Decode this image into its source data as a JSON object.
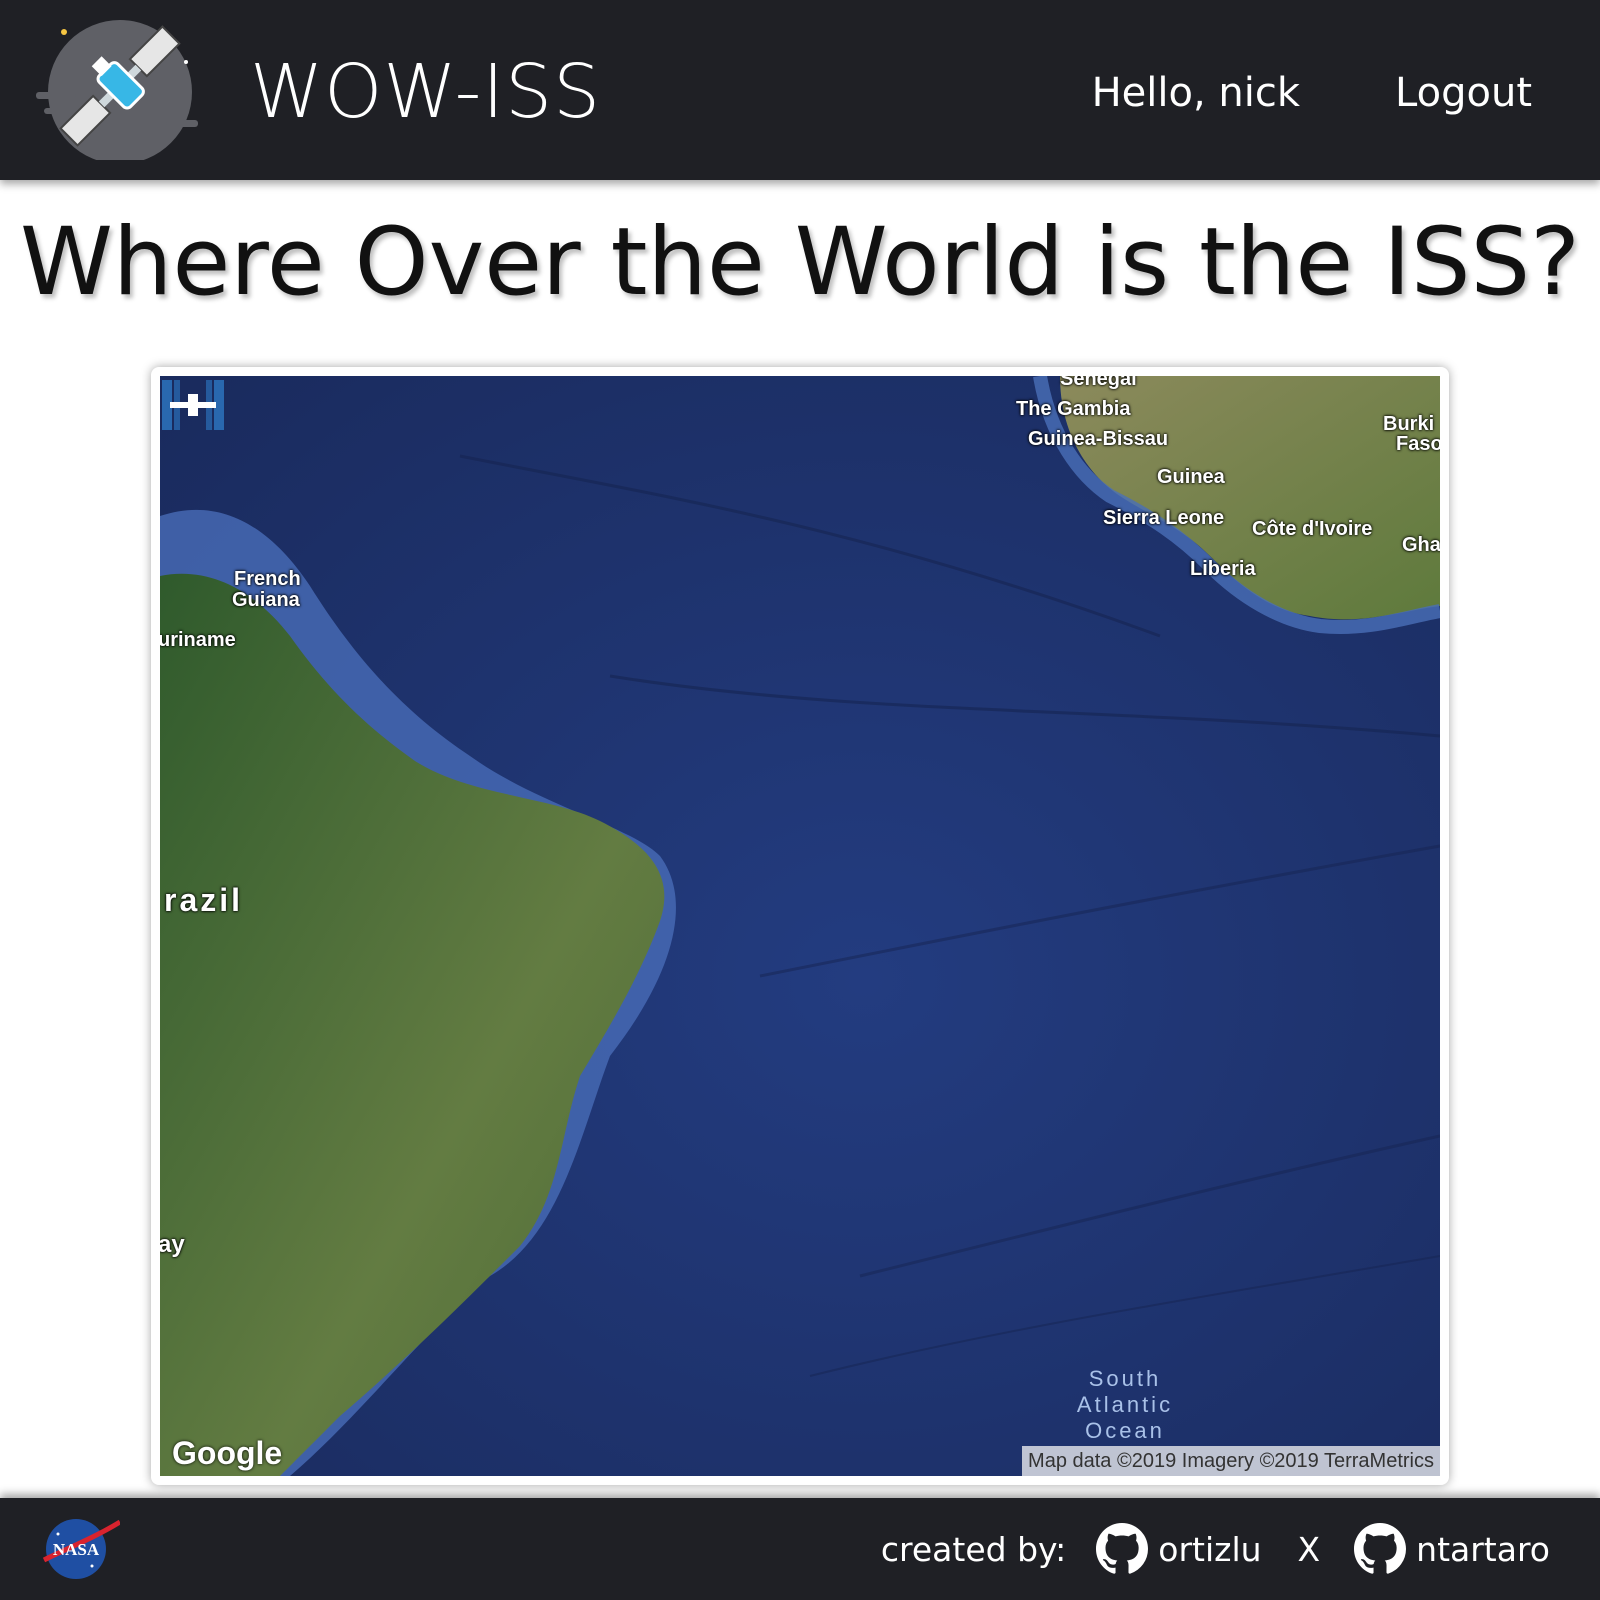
{
  "header": {
    "brand": "WOW-ISS",
    "greeting": "Hello, nick",
    "logout_label": "Logout"
  },
  "main": {
    "title": "Where Over the World is the ISS?"
  },
  "map": {
    "labels": {
      "senegal": "Senegal",
      "gambia": "The Gambia",
      "guinea_bissau": "Guinea-Bissau",
      "guinea": "Guinea",
      "sierra_leone": "Sierra Leone",
      "cote_divoire": "Côte d'Ivoire",
      "liberia": "Liberia",
      "burkina_1": "Burki",
      "burkina_2": "Faso",
      "ghana": "Gha",
      "french_guiana_1": "French",
      "french_guiana_2": "Guiana",
      "suriname": "uriname",
      "brazil": "razil",
      "paraguay": "ay",
      "ocean_1": "South",
      "ocean_2": "Atlantic",
      "ocean_3": "Ocean"
    },
    "google_logo": "Google",
    "attribution": "Map data ©2019  Imagery ©2019 TerraMetrics",
    "marker_icon": "iss-icon"
  },
  "footer": {
    "credit_label": "created by:",
    "author_1": "ortizlu",
    "separator": "X",
    "author_2": "ntartaro"
  },
  "colors": {
    "bar_background": "#1f2025",
    "ocean": "#1f3572",
    "land": "#5b7a3a"
  }
}
